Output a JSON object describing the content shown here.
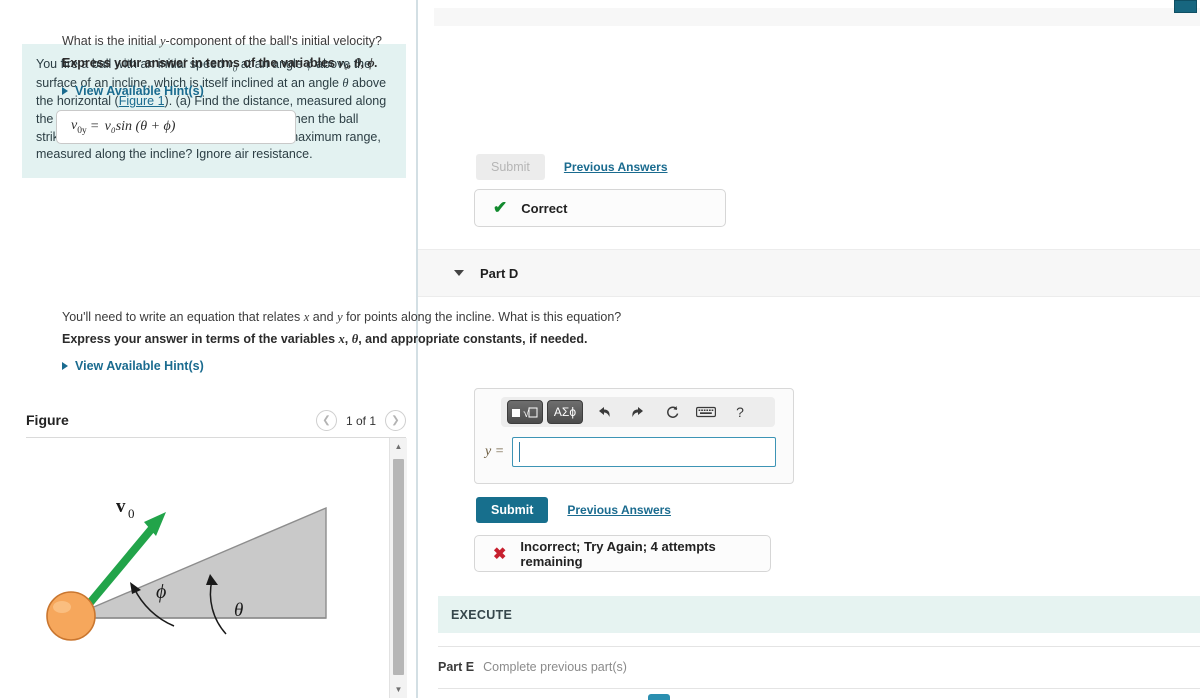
{
  "problem": {
    "text_segments": [
      "You fire a ball with an initial speed ",
      " at an angle ",
      " above the surface of an incline, which is itself inclined at an angle ",
      " above the horizontal (",
      "). (a) Find the distance, measured along the incline, from the launch point to the point when the ball strikes the incline. (b) What angle ",
      " gives the maximum range, measured along the incline? Ignore air resistance."
    ],
    "figure_link": "Figure 1",
    "var_v0": "v",
    "var_v0_sub": "0",
    "var_phi": "ϕ",
    "var_theta": "θ"
  },
  "figure": {
    "title": "Figure",
    "prev_icon": "chevron-left-icon",
    "next_icon": "chevron-right-icon",
    "count_label": "1 of 1",
    "diagram": {
      "velocity_label": "v",
      "velocity_sub": "0",
      "phi_label": "ϕ",
      "theta_label": "θ",
      "ball_color": "#f6a75c",
      "arrow_color": "#22a44a",
      "incline_color": "#c9c9c9"
    },
    "scrollbar": {
      "up_icon": "scroll-up-arrow-icon",
      "down_icon": "scroll-down-arrow-icon"
    }
  },
  "part_c": {
    "question": "What is the initial y-component of the ball's initial velocity?",
    "question_pre": "What is the initial ",
    "question_var": "y",
    "question_post": "-component of the ball's initial velocity?",
    "instruction_pre": "Express your answer in terms of the variables ",
    "instruction_vars": "v₀, θ, ϕ.",
    "hint_label": "View Available Hint(s)",
    "answer": {
      "lhs": "v",
      "lhs_sub": "0y",
      "eq": "=",
      "rhs": "v₀sin (θ + ϕ)"
    },
    "submit_label": "Submit",
    "previous_answers_label": "Previous Answers",
    "feedback": {
      "icon": "check-icon",
      "text": "Correct"
    }
  },
  "part_d": {
    "toggle_icon": "caret-down-icon",
    "label": "Part D",
    "question": "You'll need to write an equation that relates x and y for points along the incline. What is this equation?",
    "question_seg1": "You'll need to write an equation that relates ",
    "question_var1": "x",
    "question_seg2": " and ",
    "question_var2": "y",
    "question_seg3": " for points along the incline. What is this equation?",
    "instruction_seg1": "Express your answer in terms of the variables ",
    "instruction_var1": "x",
    "instruction_seg2": ", ",
    "instruction_var2": "θ",
    "instruction_seg3": ", and appropriate constants, if needed.",
    "hint_label": "View Available Hint(s)",
    "toolbar": {
      "template_button": "■√□",
      "template_icon": "math-template-icon",
      "greek_button": "ΑΣϕ",
      "greek_icon": "greek-symbols-icon",
      "undo_icon": "undo-icon",
      "redo_icon": "redo-icon",
      "reset_icon": "reset-icon",
      "keyboard_icon": "keyboard-icon",
      "help_icon": "help-icon",
      "undo_glyph": "↶",
      "redo_glyph": "↷",
      "reset_glyph": "↻",
      "keyboard_glyph": "⌨",
      "help_glyph": "?"
    },
    "answer_label": "y =",
    "answer_value": "",
    "answer_placeholder": "",
    "submit_label": "Submit",
    "previous_answers_label": "Previous Answers",
    "feedback": {
      "icon": "x-icon",
      "text": "Incorrect; Try Again; 4 attempts remaining"
    }
  },
  "execute_section": {
    "label": "EXECUTE"
  },
  "part_e": {
    "label": "Part E",
    "status": "Complete previous part(s)"
  },
  "colors": {
    "accent": "#176f8d",
    "link": "#1a6b8f",
    "problem_bg": "#e3f2f1",
    "execute_bg": "#e6f3f1",
    "correct": "#128a2e",
    "incorrect": "#c7202f"
  }
}
